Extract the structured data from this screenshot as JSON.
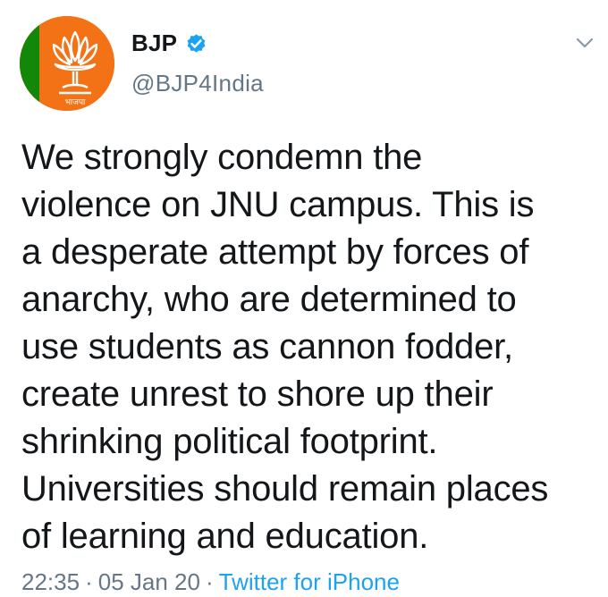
{
  "tweet": {
    "display_name": "BJP",
    "handle": "@BJP4India",
    "verified": true,
    "text": "We strongly condemn the\nviolence on JNU campus. This is\na desperate attempt by forces of\nanarchy, who are determined to\nuse students as cannon fodder,\ncreate unrest to shore up their\nshrinking political footprint.\nUniversities should remain places\nof learning and education.",
    "time": "22:35",
    "separator": "·",
    "date": "05 Jan 20",
    "source": "Twitter for iPhone"
  },
  "icons": {
    "avatar": "bjp-lotus-logo",
    "verified": "verified-badge-icon",
    "caret": "chevron-down-icon"
  },
  "colors": {
    "text": "#14171a",
    "secondary": "#657786",
    "link": "#1da1f2",
    "verified": "#1da1f2",
    "avatar_orange": "#f47216",
    "avatar_green": "#138808"
  }
}
